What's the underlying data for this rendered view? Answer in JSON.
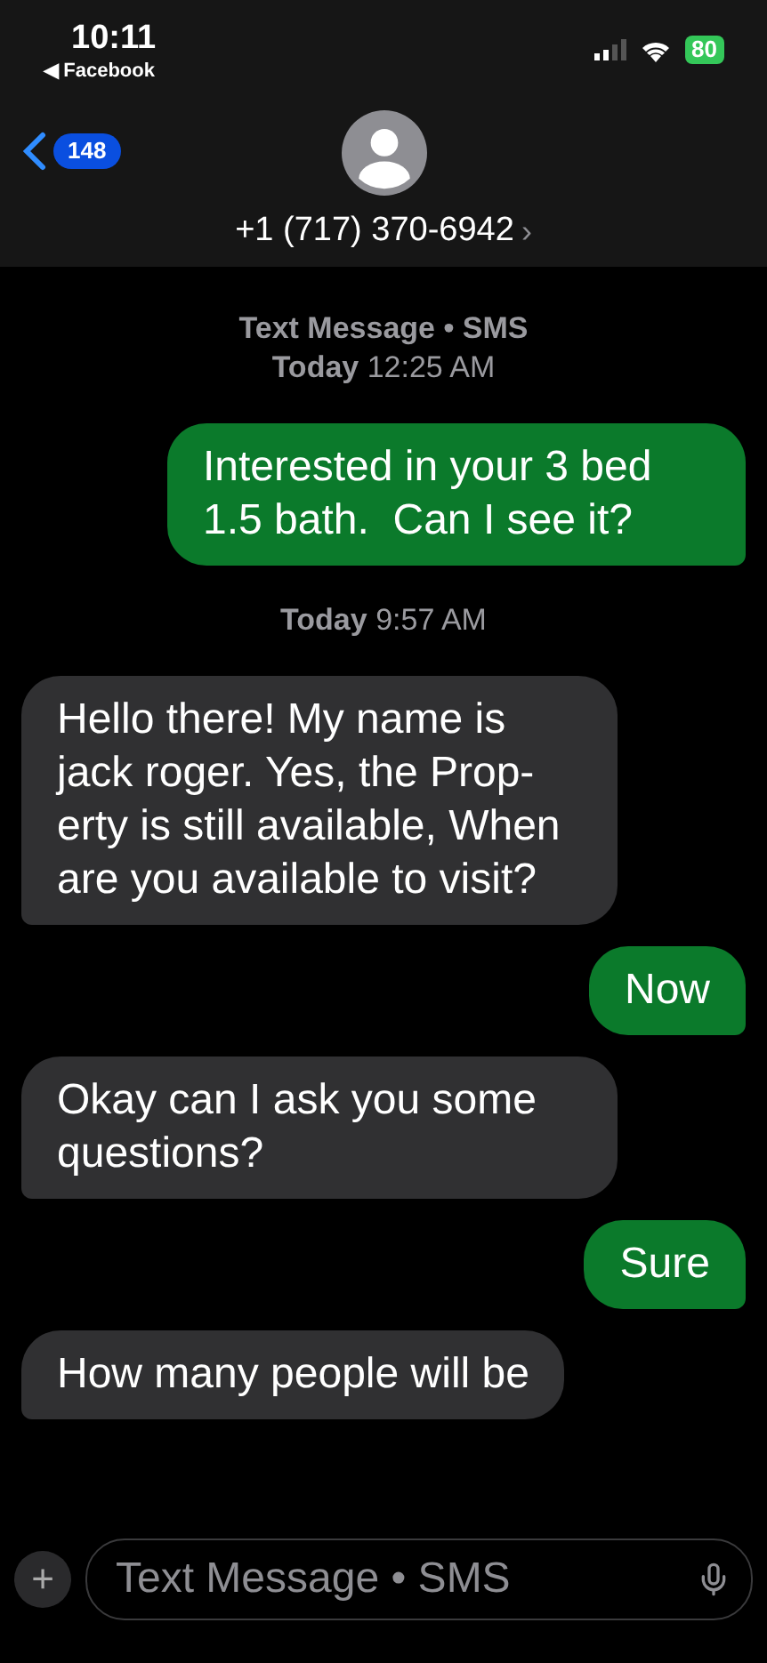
{
  "status_bar": {
    "time": "10:11",
    "back_app": "◀ Facebook",
    "battery": "80"
  },
  "header": {
    "badge": "148",
    "contact": "+1 (717) 370-6942",
    "chevron": "›"
  },
  "thread": [
    {
      "kind": "timestamp",
      "label": "Text Message • SMS",
      "time": "Today 12:25 AM"
    },
    {
      "kind": "sent",
      "text": "Interested in your 3 bed 1.5 bath.  Can I see it?"
    },
    {
      "kind": "timestamp",
      "time": "Today 9:57 AM"
    },
    {
      "kind": "received",
      "text": "Hello there! My name is jack roger. Yes, the Prop-erty is still available, When are you available to visit?"
    },
    {
      "kind": "sent",
      "text": "Now"
    },
    {
      "kind": "received",
      "text": "Okay can I ask you some questions?"
    },
    {
      "kind": "sent",
      "text": "Sure"
    },
    {
      "kind": "received",
      "text": "How many people will be"
    }
  ],
  "composer": {
    "add": "+",
    "placeholder": "Text Message • SMS"
  }
}
